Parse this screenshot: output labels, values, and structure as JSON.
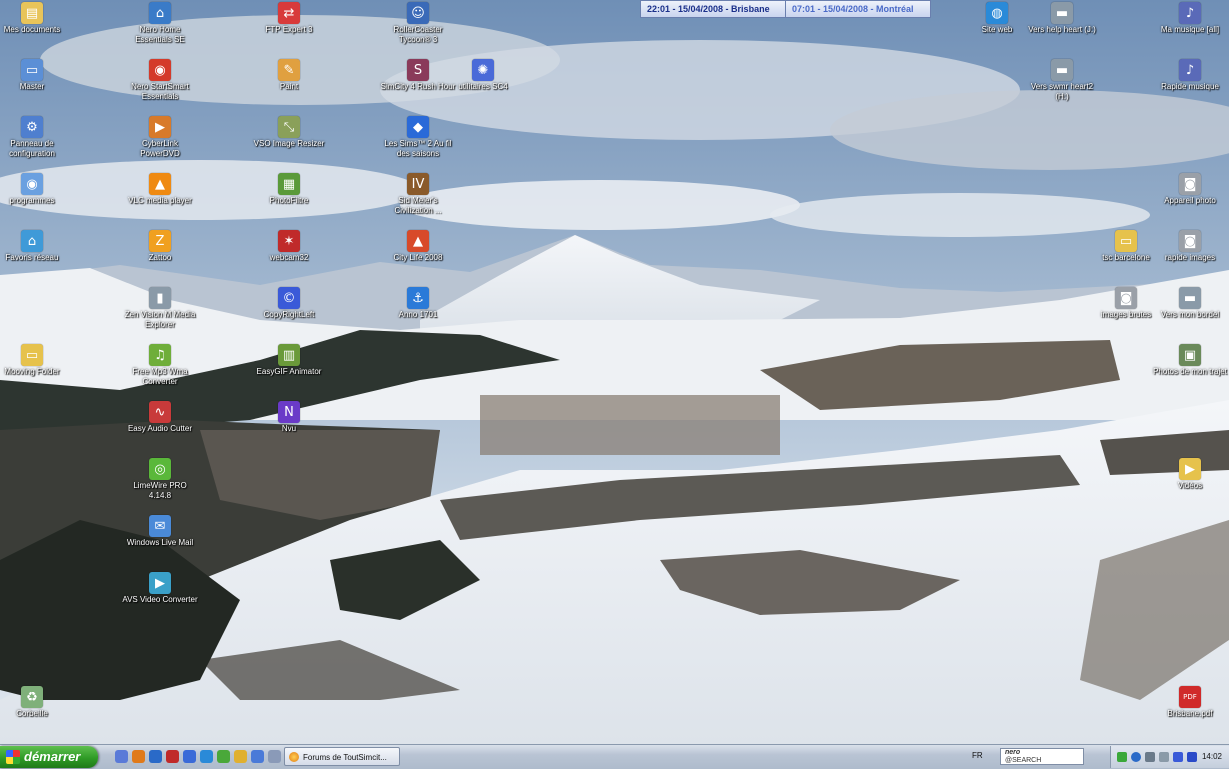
{
  "clocks": [
    {
      "text": "22:01 - 15/04/2008 - Brisbane",
      "color": "#1a2f8a"
    },
    {
      "text": "07:01 - 15/04/2008 - Montréal",
      "color": "#4a6ac8"
    }
  ],
  "desktop_icons": [
    {
      "label": "Mes documents",
      "icon": "folder-documents-icon",
      "col": 0,
      "row": 0,
      "color": "#e8c45a",
      "glyph": "▤"
    },
    {
      "label": "Master",
      "icon": "computer-icon",
      "col": 0,
      "row": 1,
      "color": "#5b8fd6",
      "glyph": "▭"
    },
    {
      "label": "Panneau de configuration",
      "icon": "control-panel-icon",
      "col": 0,
      "row": 2,
      "color": "#4f7fcf",
      "glyph": "⚙"
    },
    {
      "label": "programmes",
      "icon": "programs-icon",
      "col": 0,
      "row": 3,
      "color": "#6aa0e0",
      "glyph": "◉"
    },
    {
      "label": "Favoris réseau",
      "icon": "network-icon",
      "col": 0,
      "row": 4,
      "color": "#3f9ad8",
      "glyph": "⌂"
    },
    {
      "label": "Mooving Folder",
      "icon": "folder-icon",
      "col": 0,
      "row": 6,
      "color": "#e6c24c",
      "glyph": "▭"
    },
    {
      "label": "Corbeille",
      "icon": "recycle-bin-icon",
      "col": 0,
      "row": 12,
      "color": "#7fb07a",
      "glyph": "♻"
    },
    {
      "label": "Nero Home Essentials SE",
      "icon": "nero-home-icon",
      "col": 1,
      "row": 0,
      "color": "#3a7bc8",
      "glyph": "⌂"
    },
    {
      "label": "Nero StartSmart Essentials",
      "icon": "nero-startsmart-icon",
      "col": 1,
      "row": 1,
      "color": "#d43a2a",
      "glyph": "◉"
    },
    {
      "label": "CyberLink PowerDVD",
      "icon": "powerdvd-icon",
      "col": 1,
      "row": 2,
      "color": "#d87a2a",
      "glyph": "▶"
    },
    {
      "label": "VLC media player",
      "icon": "vlc-icon",
      "col": 1,
      "row": 3,
      "color": "#ef8a12",
      "glyph": "▲"
    },
    {
      "label": "Zattoo",
      "icon": "zattoo-icon",
      "col": 1,
      "row": 4,
      "color": "#f0a020",
      "glyph": "Z"
    },
    {
      "label": "Zen Vision M Media Explorer",
      "icon": "zen-vision-icon",
      "col": 1,
      "row": 5,
      "color": "#8a9aa8",
      "glyph": "▮"
    },
    {
      "label": "Free Mp3 Wma Converter",
      "icon": "converter-icon",
      "col": 1,
      "row": 6,
      "color": "#6fae3a",
      "glyph": "♫"
    },
    {
      "label": "Easy Audio Cutter",
      "icon": "audio-cutter-icon",
      "col": 1,
      "row": 7,
      "color": "#c83a3a",
      "glyph": "∿"
    },
    {
      "label": "LimeWire PRO 4.14.8",
      "icon": "limewire-icon",
      "col": 1,
      "row": 8,
      "color": "#5ab83a",
      "glyph": "◎"
    },
    {
      "label": "Windows Live Mail",
      "icon": "live-mail-icon",
      "col": 1,
      "row": 9,
      "color": "#4a8ad8",
      "glyph": "✉"
    },
    {
      "label": "AVS Video Converter",
      "icon": "avs-video-icon",
      "col": 1,
      "row": 10,
      "color": "#3aa0c8",
      "glyph": "▶"
    },
    {
      "label": "FTP Expert 3",
      "icon": "ftp-icon",
      "col": 2,
      "row": 0,
      "color": "#d83a3a",
      "glyph": "⇄"
    },
    {
      "label": "Paint",
      "icon": "paint-icon",
      "col": 2,
      "row": 1,
      "color": "#e0a040",
      "glyph": "✎"
    },
    {
      "label": "VSO Image Resizer",
      "icon": "image-resizer-icon",
      "col": 2,
      "row": 2,
      "color": "#8aa05a",
      "glyph": "⤡"
    },
    {
      "label": "PhotoFiltre",
      "icon": "photofiltre-icon",
      "col": 2,
      "row": 3,
      "color": "#5a9a3a",
      "glyph": "▦"
    },
    {
      "label": "webcam32",
      "icon": "webcam-icon",
      "col": 2,
      "row": 4,
      "color": "#c02a2a",
      "glyph": "✶"
    },
    {
      "label": "CopyRightLeft",
      "icon": "copyright-icon",
      "col": 2,
      "row": 5,
      "color": "#3a5ad8",
      "glyph": "©"
    },
    {
      "label": "EasyGIF Animator",
      "icon": "gif-animator-icon",
      "col": 2,
      "row": 6,
      "color": "#6a9a3a",
      "glyph": "▥"
    },
    {
      "label": "Nvu",
      "icon": "nvu-icon",
      "col": 2,
      "row": 7,
      "color": "#6a3ac8",
      "glyph": "N"
    },
    {
      "label": "RollerCoaster Tycoon® 3",
      "icon": "rollercoaster-icon",
      "col": 3,
      "row": 0,
      "color": "#3a6ab8",
      "glyph": "☺"
    },
    {
      "label": "SimCity 4 Rush Hour",
      "icon": "simcity-icon",
      "col": 3,
      "row": 1,
      "color": "#8a3a5a",
      "glyph": "S"
    },
    {
      "label": "Les Sims™ 2 Au fil des saisons",
      "icon": "sims-icon",
      "col": 3,
      "row": 2,
      "color": "#2a6ad8",
      "glyph": "◆"
    },
    {
      "label": "Sid Meier's Civilization ...",
      "icon": "civilization-icon",
      "col": 3,
      "row": 3,
      "color": "#8a5a2a",
      "glyph": "IV"
    },
    {
      "label": "City Life 2008",
      "icon": "city-life-icon",
      "col": 3,
      "row": 4,
      "color": "#d84a2a",
      "glyph": "▲"
    },
    {
      "label": "Anno 1701",
      "icon": "anno-icon",
      "col": 3,
      "row": 5,
      "color": "#2a7ad8",
      "glyph": "⚓"
    },
    {
      "label": "utilitaires SC4",
      "icon": "gear-icon",
      "col": 4,
      "row": 1,
      "color": "#4a6ad8",
      "glyph": "✺"
    },
    {
      "label": "Site web",
      "icon": "globe-icon",
      "col": 5,
      "row": 0,
      "color": "#2a8ad8",
      "glyph": "◍"
    },
    {
      "label": "Vers help heart (J:)",
      "icon": "network-drive-icon",
      "col": 6,
      "row": 0,
      "color": "#8a9aa8",
      "glyph": "▬"
    },
    {
      "label": "Vers swmr heart2 (H:)",
      "icon": "network-drive-icon-2",
      "col": 6,
      "row": 1,
      "color": "#8a9aa8",
      "glyph": "▬"
    },
    {
      "label": "Ma musique [all]",
      "icon": "music-icon",
      "col": 8,
      "row": 0,
      "color": "#5a6ab8",
      "glyph": "♪"
    },
    {
      "label": "Rapide musique",
      "icon": "music-icon-2",
      "col": 8,
      "row": 1,
      "color": "#5a6ab8",
      "glyph": "♪"
    },
    {
      "label": "Appareil photo",
      "icon": "camera-icon",
      "col": 8,
      "row": 3,
      "color": "#9aa0a8",
      "glyph": "◙"
    },
    {
      "label": "tsc barcelone",
      "icon": "folder-icon-2",
      "col": 7,
      "row": 4,
      "color": "#e6c24c",
      "glyph": "▭"
    },
    {
      "label": "rapide images",
      "icon": "camera-icon-2",
      "col": 8,
      "row": 4,
      "color": "#9aa0a8",
      "glyph": "◙"
    },
    {
      "label": "images brutes",
      "icon": "camera-icon-3",
      "col": 7,
      "row": 5,
      "color": "#9aa0a8",
      "glyph": "◙"
    },
    {
      "label": "Vers mon bordel",
      "icon": "network-drive-icon-3",
      "col": 8,
      "row": 5,
      "color": "#8a9aa8",
      "glyph": "▬"
    },
    {
      "label": "Photos de mon trajet",
      "icon": "photo-folder-icon",
      "col": 8,
      "row": 6,
      "color": "#6a8a5a",
      "glyph": "▣"
    },
    {
      "label": "Vidéos",
      "icon": "videos-folder-icon",
      "col": 8,
      "row": 8,
      "color": "#e6c24c",
      "glyph": "▶"
    },
    {
      "label": "Brisbane.pdf",
      "icon": "pdf-icon",
      "col": 8,
      "row": 12,
      "color": "#d02a2a",
      "glyph": "PDF"
    }
  ],
  "taskbar": {
    "start_label": "démarrer",
    "quick_launch": [
      {
        "icon": "show-desktop-icon",
        "color": "#5a7ad8"
      },
      {
        "icon": "firefox-icon",
        "color": "#e07a1a"
      },
      {
        "icon": "ftp-quick-icon",
        "color": "#2a6ac8"
      },
      {
        "icon": "webcam-quick-icon",
        "color": "#c02a2a"
      },
      {
        "icon": "media-player-icon",
        "color": "#3a6ad8"
      },
      {
        "icon": "ie-icon",
        "color": "#2a8ad8"
      },
      {
        "icon": "messenger-icon",
        "color": "#4aa83a"
      },
      {
        "icon": "outlook-icon",
        "color": "#e0b030"
      },
      {
        "icon": "mail-icon",
        "color": "#4a7ad8"
      },
      {
        "icon": "calendar-icon",
        "color": "#8a9ab8"
      }
    ],
    "task_button_label": "Forums de ToutSimcit...",
    "language": "FR",
    "search_brand_top": "nero",
    "search_brand_bottom": "@SEARCH",
    "clock": "14:02"
  }
}
